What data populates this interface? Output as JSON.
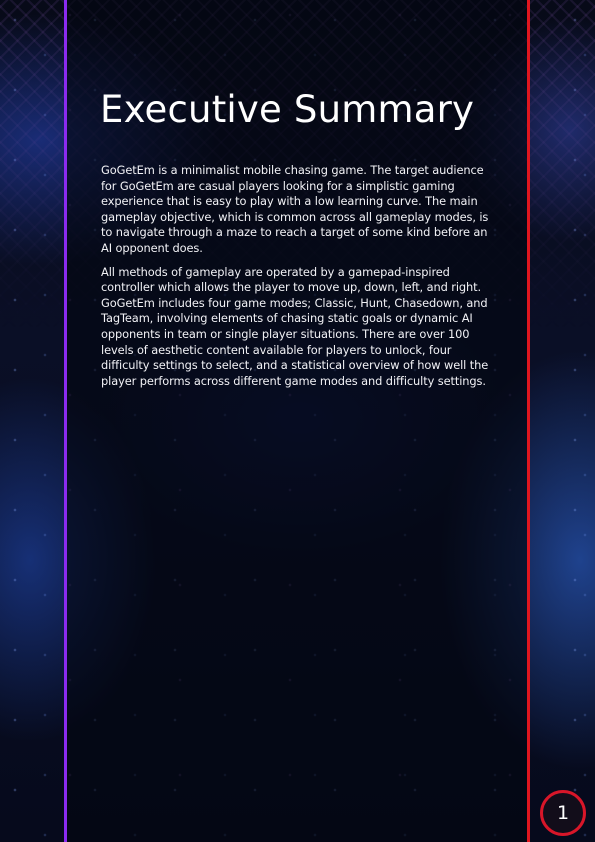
{
  "document": {
    "title": "Executive Summary",
    "paragraphs": [
      "GoGetEm is a minimalist mobile chasing game. The target audience for GoGetEm are casual players looking for a simplistic gaming experience that is easy to play with a low learning curve. The main gameplay objective, which is common across all gameplay modes, is to navigate through a maze to reach a target of some kind before an AI opponent does.",
      "All methods of gameplay are operated by a gamepad-inspired controller which allows the player to move up, down, left, and right. GoGetEm includes four game modes; Classic, Hunt, Chasedown, and TagTeam, involving elements of chasing static goals or dynamic AI opponents in team or single player situations. There are over 100 levels of aesthetic content available for players to unlock, four difficulty settings to select, and a statistical overview of how well the player performs across different game modes and difficulty settings."
    ],
    "page_number": "1"
  },
  "colors": {
    "left_rule": "#8b2bf0",
    "right_rule": "#e0161f",
    "badge_border": "#d81629",
    "text": "#ffffff"
  }
}
